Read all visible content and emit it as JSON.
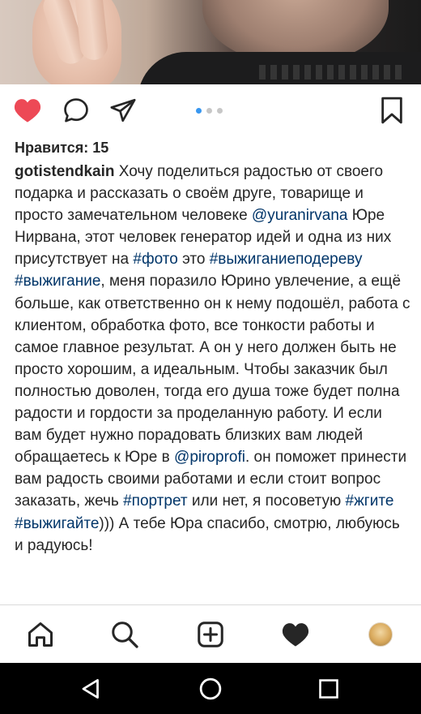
{
  "post": {
    "likes_text": "Нравится: 15",
    "carousel": {
      "count": 3,
      "active": 0
    }
  },
  "caption": {
    "username": "gotistendkain",
    "segments": [
      {
        "t": " Хочу поделиться радостью от своего подарка и рассказать о своём друге, товарище и просто замечательном человеке "
      },
      {
        "t": "@yuranirvana",
        "link": true
      },
      {
        "t": " Юре Нирвана, этот человек генератор идей и одна из них присутствует на "
      },
      {
        "t": "#фото",
        "link": true
      },
      {
        "t": " это "
      },
      {
        "t": "#выжиганиеподереву",
        "link": true
      },
      {
        "t": " "
      },
      {
        "t": "#выжигание",
        "link": true
      },
      {
        "t": ", меня поразило Юрино увлечение, а ещё больше, как ответственно он к нему подошёл, работа с клиентом, обработка фото, все тонкости работы и самое главное результат. А он у него должен быть не просто хорошим, а идеальным. Чтобы заказчик был полностью доволен, тогда его душа тоже будет полна радости и гордости за проделанную работу. И если вам будет нужно порадовать близких вам людей обращаетесь к Юре в  "
      },
      {
        "t": "@piroprofi",
        "link": true
      },
      {
        "t": ". он поможет принести вам радость своими работами и если стоит вопрос заказать, жечь "
      },
      {
        "t": "#портрет",
        "link": true
      },
      {
        "t": " или нет, я посоветую "
      },
      {
        "t": "#жгите",
        "link": true
      },
      {
        "t": " "
      },
      {
        "t": "#выжигайте",
        "link": true
      },
      {
        "t": "))) А тебе Юра спасибо, смотрю, любуюсь и радуюсь!"
      }
    ]
  },
  "icons": {
    "like": "heart-filled-icon",
    "comment": "comment-bubble-icon",
    "share": "paper-plane-icon",
    "save": "bookmark-icon",
    "nav_home": "home-icon",
    "nav_search": "search-icon",
    "nav_add": "add-post-icon",
    "nav_activity": "heart-icon",
    "nav_profile": "profile-avatar",
    "sys_back": "back-triangle-icon",
    "sys_home": "home-circle-icon",
    "sys_recents": "recents-square-icon"
  },
  "colors": {
    "like_red": "#ed4956",
    "link_blue": "#003569",
    "dot_active": "#3897f0",
    "dot_inactive": "#c7c7c7",
    "text": "#262626",
    "system_bar": "#000000"
  }
}
